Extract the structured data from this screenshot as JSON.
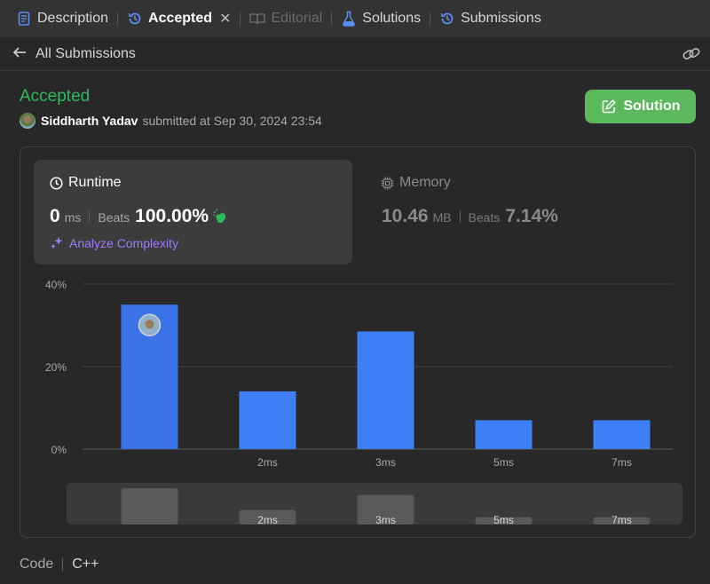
{
  "tabs": [
    {
      "label": "Description",
      "icon": "description-icon",
      "state": "normal"
    },
    {
      "label": "Accepted",
      "icon": "history-icon",
      "state": "active"
    },
    {
      "label": "Editorial",
      "icon": "book-icon",
      "state": "disabled"
    },
    {
      "label": "Solutions",
      "icon": "flask-icon",
      "state": "normal"
    },
    {
      "label": "Submissions",
      "icon": "history-icon",
      "state": "normal"
    }
  ],
  "subheader": {
    "title": "All Submissions"
  },
  "submission": {
    "status": "Accepted",
    "user": "Siddharth Yadav",
    "submitted_text": "submitted at Sep 30, 2024 23:54",
    "solution_button": "Solution"
  },
  "runtime": {
    "title": "Runtime",
    "value": "0",
    "unit": "ms",
    "beats_label": "Beats",
    "beats_value": "100.00%",
    "analyze_label": "Analyze Complexity"
  },
  "memory": {
    "title": "Memory",
    "value": "10.46",
    "unit": "MB",
    "beats_label": "Beats",
    "beats_value": "7.14%"
  },
  "code": {
    "label": "Code",
    "language": "C++"
  },
  "colors": {
    "accepted": "#2cbb5d",
    "button": "#5cb85c",
    "bar": "#3e7ff5",
    "analyze": "#9b7dff"
  },
  "chart_data": {
    "type": "bar",
    "categories": [
      "",
      "2ms",
      "3ms",
      "5ms",
      "7ms"
    ],
    "values": [
      35.0,
      14.0,
      28.5,
      7.0,
      7.0
    ],
    "highlight_index": 0,
    "yticks": [
      "40%",
      "20%",
      "0%"
    ],
    "ylim": [
      0,
      40
    ],
    "grid": true,
    "navigator": {
      "categories": [
        "",
        "2ms",
        "3ms",
        "5ms",
        "7ms"
      ],
      "values": [
        35.0,
        14.0,
        28.5,
        7.0,
        7.0
      ]
    }
  }
}
